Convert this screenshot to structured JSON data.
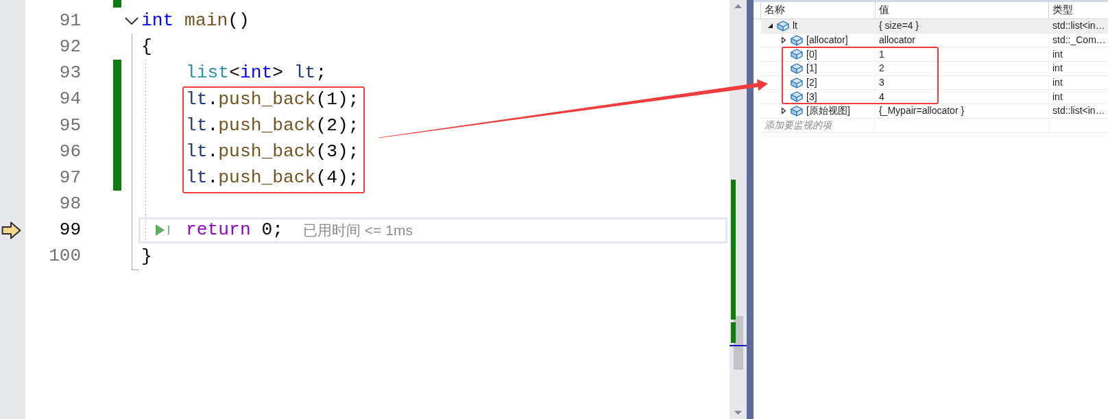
{
  "editor": {
    "lines": [
      {
        "kind": "partial",
        "changed": true,
        "current": false,
        "marked": false
      },
      {
        "number": "91",
        "kind": "fold",
        "expanded": true,
        "changed": false,
        "current": false,
        "marked": false,
        "tokens": [
          {
            "kind": "keyword",
            "text": "int"
          },
          {
            "kind": "function",
            "text": " main"
          },
          {
            "kind": "plain",
            "text": "()"
          }
        ],
        "children": [
          {
            "number": "92",
            "kind": "block",
            "changed": false,
            "current": false,
            "marked": false,
            "tokens": [
              {
                "kind": "plain",
                "text": "{"
              }
            ],
            "children": [
              {
                "number": "93",
                "kind": "plain",
                "changed": true,
                "current": false,
                "marked": false,
                "tokens": [
                  {
                    "kind": "type",
                    "text": "list"
                  },
                  {
                    "kind": "plain",
                    "text": "<"
                  },
                  {
                    "kind": "keyword",
                    "text": "int"
                  },
                  {
                    "kind": "plain",
                    "text": ">"
                  },
                  {
                    "kind": "variable",
                    "text": " lt"
                  },
                  {
                    "kind": "plain",
                    "text": ";"
                  }
                ]
              },
              {
                "number": "94",
                "kind": "plain",
                "changed": true,
                "current": false,
                "marked": true,
                "tokens": [
                  {
                    "kind": "variable",
                    "text": "lt"
                  },
                  {
                    "kind": "plain",
                    "text": "."
                  },
                  {
                    "kind": "function",
                    "text": "push_back"
                  },
                  {
                    "kind": "plain",
                    "text": "(1);"
                  }
                ]
              },
              {
                "number": "95",
                "kind": "plain",
                "changed": true,
                "current": false,
                "marked": true,
                "tokens": [
                  {
                    "kind": "variable",
                    "text": "lt"
                  },
                  {
                    "kind": "plain",
                    "text": "."
                  },
                  {
                    "kind": "function",
                    "text": "push_back"
                  },
                  {
                    "kind": "plain",
                    "text": "(2);"
                  }
                ]
              },
              {
                "number": "96",
                "kind": "plain",
                "changed": true,
                "current": false,
                "marked": true,
                "tokens": [
                  {
                    "kind": "variable",
                    "text": "lt"
                  },
                  {
                    "kind": "plain",
                    "text": "."
                  },
                  {
                    "kind": "function",
                    "text": "push_back"
                  },
                  {
                    "kind": "plain",
                    "text": "(3);"
                  }
                ]
              },
              {
                "number": "97",
                "kind": "plain",
                "changed": true,
                "current": false,
                "marked": true,
                "tokens": [
                  {
                    "kind": "variable",
                    "text": "lt"
                  },
                  {
                    "kind": "plain",
                    "text": "."
                  },
                  {
                    "kind": "function",
                    "text": "push_back"
                  },
                  {
                    "kind": "plain",
                    "text": "(4);"
                  }
                ]
              },
              {
                "number": "98",
                "kind": "plain",
                "changed": false,
                "current": false,
                "marked": false
              },
              {
                "number": "99",
                "kind": "plain",
                "changed": false,
                "current": true,
                "marked": false,
                "tokens": [
                  {
                    "kind": "control",
                    "text": "return"
                  },
                  {
                    "kind": "plain",
                    "text": " 0;"
                  }
                ],
                "hint": "已用时间 <= 1ms"
              }
            ]
          },
          {
            "number": "100",
            "kind": "plain",
            "changed": false,
            "current": false,
            "marked": false,
            "tokens": [
              {
                "kind": "plain",
                "text": "}"
              }
            ]
          }
        ]
      }
    ]
  },
  "watch": {
    "columns": [
      "名称",
      "值",
      "类型"
    ],
    "rows": [
      {
        "kind": "node",
        "name": "lt",
        "value": "{ size=4 }",
        "type": "std::list<in…",
        "expanded": true,
        "selected": true,
        "marked": false,
        "children": [
          {
            "kind": "node",
            "name": "[allocator]",
            "value": "allocator",
            "type": "std::_Com…",
            "expanded": false,
            "selected": false,
            "marked": false
          },
          {
            "kind": "leaf",
            "name": "[0]",
            "value": "1",
            "type": "int",
            "selected": false,
            "marked": true
          },
          {
            "kind": "leaf",
            "name": "[1]",
            "value": "2",
            "type": "int",
            "selected": false,
            "marked": true
          },
          {
            "kind": "leaf",
            "name": "[2]",
            "value": "3",
            "type": "int",
            "selected": false,
            "marked": true
          },
          {
            "kind": "leaf",
            "name": "[3]",
            "value": "4",
            "type": "int",
            "selected": false,
            "marked": true
          },
          {
            "kind": "node",
            "name": "[原始视图]",
            "value": "{_Mypair=allocator }",
            "type": "std::list<in…",
            "expanded": false,
            "selected": false,
            "marked": false
          }
        ]
      }
    ],
    "add_placeholder": "添加要监视的项"
  },
  "annotation_arrow": true
}
